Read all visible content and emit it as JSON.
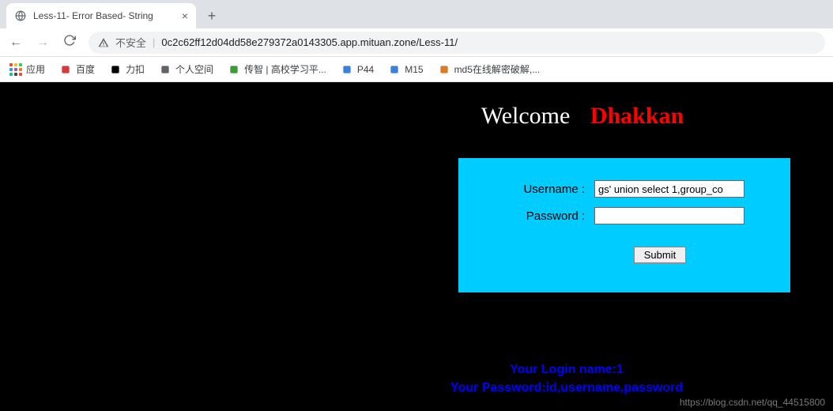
{
  "browser": {
    "tab_title": "Less-11- Error Based- String",
    "insecure_label": "不安全",
    "url": "0c2c62ff12d04dd58e279372a0143305.app.mituan.zone/Less-11/"
  },
  "bookmarks": {
    "apps": "应用",
    "items": [
      {
        "label": "百度",
        "color": "#d23c3c"
      },
      {
        "label": "力扣",
        "color": "#000"
      },
      {
        "label": "个人空间",
        "color": "#5f6368"
      },
      {
        "label": "传智 | 高校学习平...",
        "color": "#3b9b3b"
      },
      {
        "label": "P44",
        "color": "#3b82d6"
      },
      {
        "label": "M15",
        "color": "#3b82d6"
      },
      {
        "label": "md5在线解密破解,...",
        "color": "#d87b2a"
      }
    ]
  },
  "page": {
    "welcome_text": "Welcome",
    "welcome_name": "Dhakkan",
    "form": {
      "username_label": "Username :",
      "password_label": "Password :",
      "username_value": "gs' union select 1,group_co",
      "password_value": "",
      "submit_label": "Submit"
    },
    "result": {
      "line1": "Your Login name:1",
      "line2": "Your Password:id,username,password"
    },
    "watermark": "https://blog.csdn.net/qq_44515800"
  }
}
